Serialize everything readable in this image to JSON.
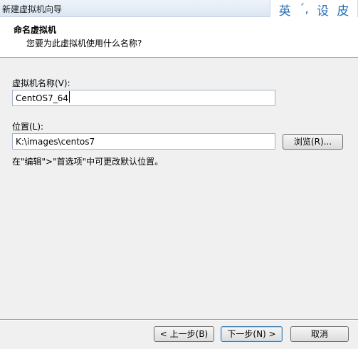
{
  "window": {
    "title": "新建虚拟机向导"
  },
  "ime": {
    "chars": [
      "英",
      "ˊ,",
      "设",
      "皮"
    ]
  },
  "header": {
    "title": "命名虚拟机",
    "subtitle": "您要为此虚拟机使用什么名称?"
  },
  "form": {
    "name_label": "虚拟机名称(V):",
    "name_value": "CentOS7_64",
    "location_label": "位置(L):",
    "location_value": "K:\\images\\centos7",
    "browse_label": "浏览(R)...",
    "hint": "在\"编辑\">\"首选项\"中可更改默认位置。"
  },
  "footer": {
    "back_label": "< 上一步(B)",
    "next_label": "下一步(N) >",
    "cancel_label": "取消"
  },
  "colors": {
    "accent": "#2a6db3",
    "dialog_bg": "#f0f0f0",
    "header_bg": "#ffffff"
  }
}
